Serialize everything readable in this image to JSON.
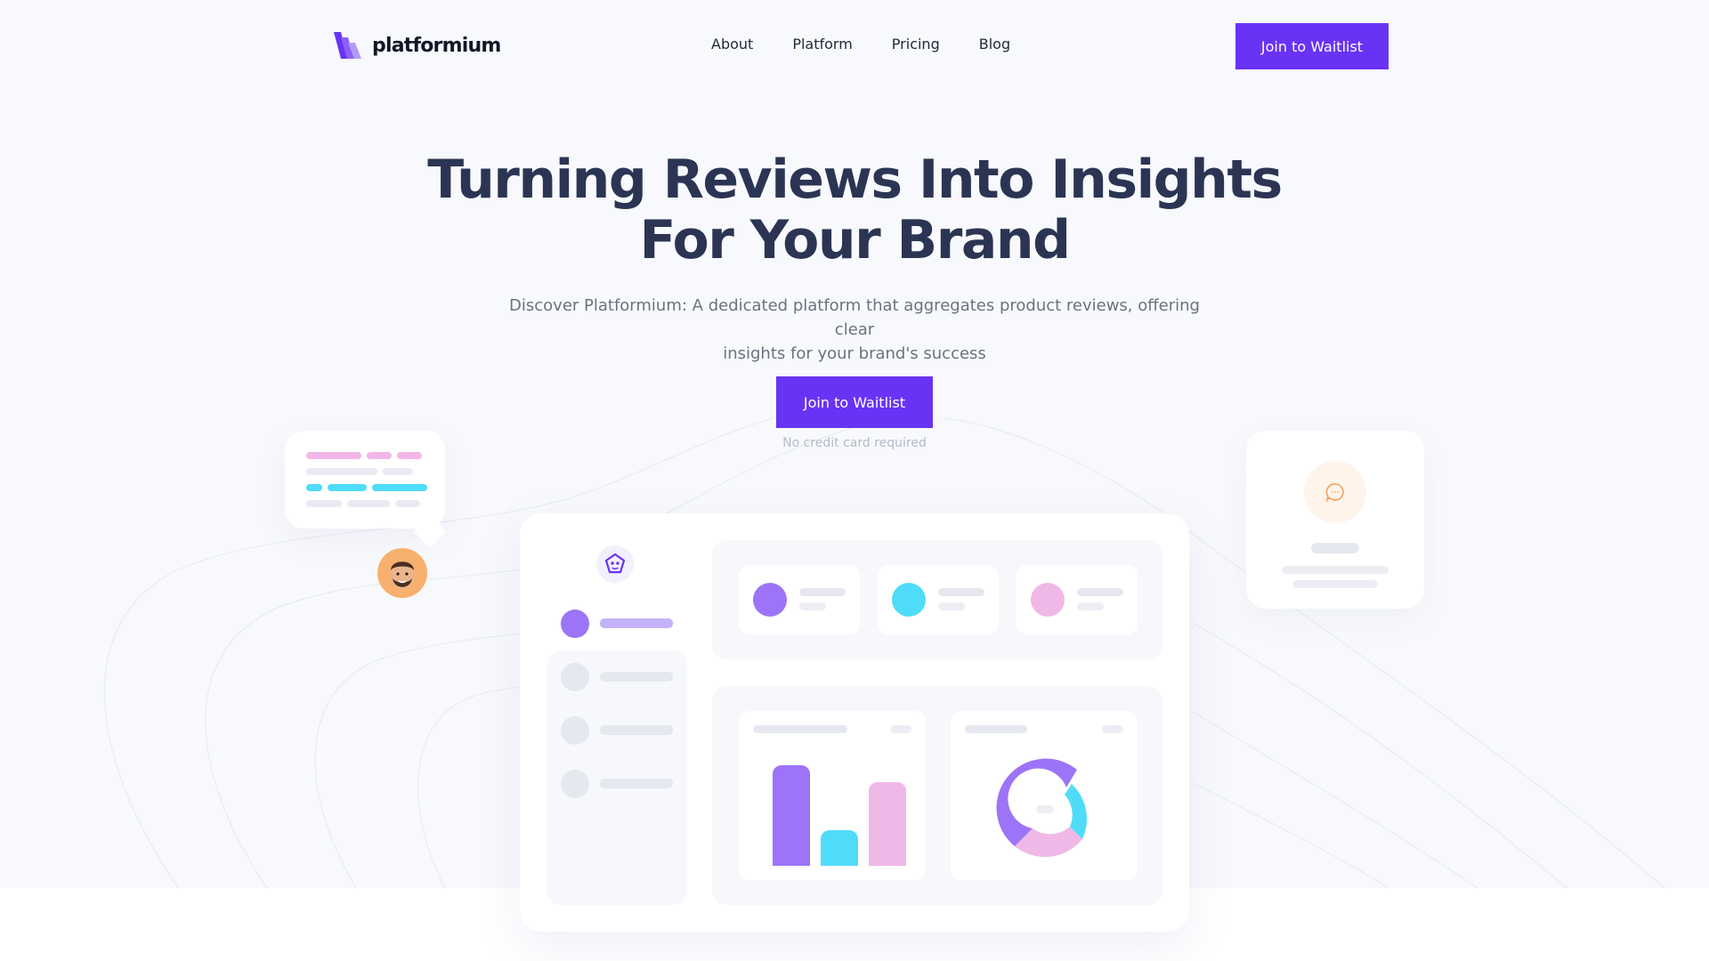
{
  "brand": {
    "name": "platformium",
    "logo_icon": "stacked-bars-logo-icon",
    "accent": "#6933f5"
  },
  "nav": {
    "items": [
      "About",
      "Platform",
      "Pricing",
      "Blog"
    ]
  },
  "header": {
    "cta_label": "Join to Waitlist"
  },
  "hero": {
    "title_line1": "Turning Reviews Into Insights",
    "title_line2": "For Your Brand",
    "subtitle_line1": "Discover Platformium: A dedicated platform that aggregates product reviews, offering clear",
    "subtitle_line2": "insights for your brand's success",
    "cta_label": "Join to Waitlist",
    "note": "No credit card required"
  },
  "colors": {
    "purple": "#9b74f7",
    "cyan": "#4fdcf8",
    "pink": "#f0b8e6",
    "heading": "#2b3553",
    "muted": "#6b7280"
  },
  "icons": {
    "dashboard_logo": "flower-icon",
    "chat": "chat-bubble-icon",
    "avatar": "man-avatar"
  },
  "dashboard": {
    "bar_chart_values": [
      96,
      34,
      80
    ]
  }
}
